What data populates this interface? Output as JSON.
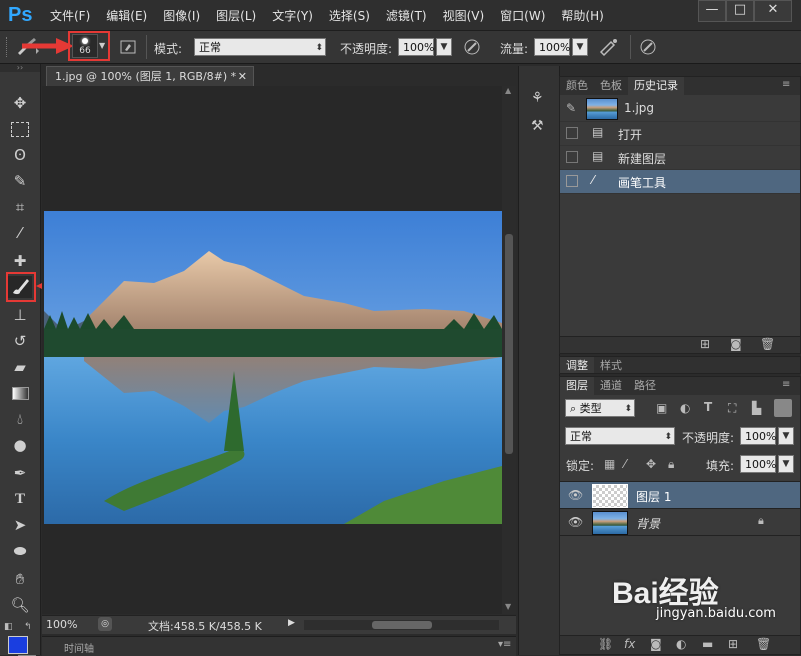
{
  "app": {
    "logo": "Ps"
  },
  "menu": [
    "文件(F)",
    "编辑(E)",
    "图像(I)",
    "图层(L)",
    "文字(Y)",
    "选择(S)",
    "滤镜(T)",
    "视图(V)",
    "窗口(W)",
    "帮助(H)"
  ],
  "window_controls": {
    "minimize": "—",
    "maximize": "□",
    "close": "✕"
  },
  "options": {
    "brush_size": "66",
    "mode_label": "模式:",
    "mode_value": "正常",
    "opacity_label": "不透明度:",
    "opacity_value": "100%",
    "flow_label": "流量:",
    "flow_value": "100%"
  },
  "document": {
    "tab_title": "1.jpg @ 100% (图层 1, RGB/8#) *",
    "zoom": "100%",
    "doc_info": "文档:458.5 K/458.5 K",
    "timeline_label": "时间轴"
  },
  "history_panel": {
    "tabs": [
      "颜色",
      "色板",
      "历史记录"
    ],
    "active_tab": "历史记录",
    "snapshot": "1.jpg",
    "items": [
      {
        "label": "打开",
        "selected": false
      },
      {
        "label": "新建图层",
        "selected": false
      },
      {
        "label": "画笔工具",
        "selected": true
      }
    ]
  },
  "adjust_panel": {
    "tabs": [
      "调整",
      "样式"
    ]
  },
  "layers_panel": {
    "tabs": [
      "图层",
      "通道",
      "路径"
    ],
    "filter_kind": "类型",
    "blend_mode": "正常",
    "opacity_label": "不透明度:",
    "opacity_value": "100%",
    "lock_label": "锁定:",
    "fill_label": "填充:",
    "fill_value": "100%",
    "layers": [
      {
        "name": "图层 1",
        "selected": true,
        "locked": false
      },
      {
        "name": "背景",
        "selected": false,
        "locked": true
      }
    ]
  },
  "watermark": {
    "brand": "Bai经验",
    "url": "jingyan.baidu.com"
  },
  "colors": {
    "accent": "#31a8ff",
    "selection": "#4f6780",
    "highlight": "#e53935",
    "foreground": "#1a3ee0"
  }
}
